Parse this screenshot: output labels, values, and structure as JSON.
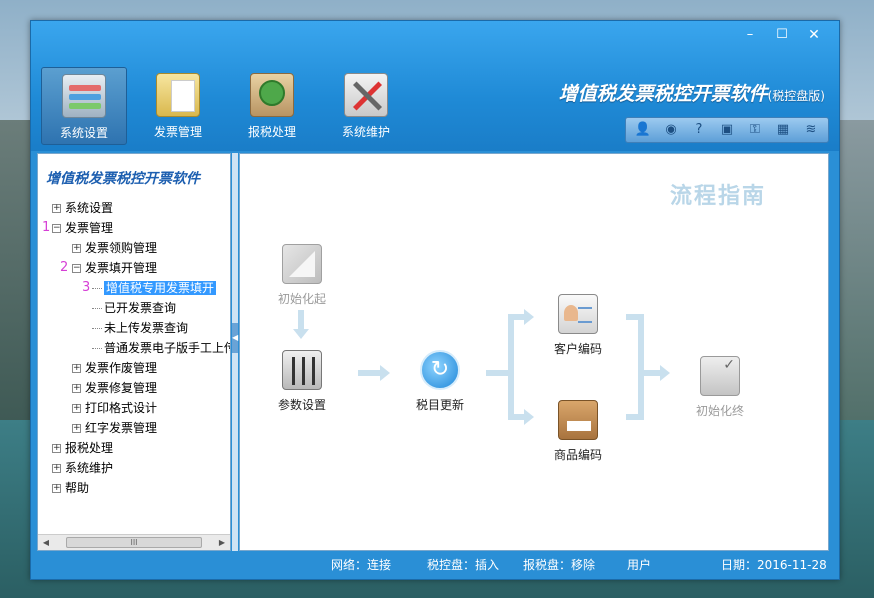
{
  "window": {
    "controls": {
      "minimize": "–",
      "maximize": "☐",
      "close": "✕"
    }
  },
  "toolbar": [
    {
      "label": "系统设置",
      "icon": "settings-panel-icon",
      "active": true
    },
    {
      "label": "发票管理",
      "icon": "invoice-folder-icon",
      "active": false
    },
    {
      "label": "报税处理",
      "icon": "tax-report-icon",
      "active": false
    },
    {
      "label": "系统维护",
      "icon": "maintenance-tools-icon",
      "active": false
    }
  ],
  "brand": {
    "title": "增值税发票税控开票软件",
    "edition": "(税控盘版)"
  },
  "quickbar": [
    {
      "icon": "user-icon",
      "glyph": "👤"
    },
    {
      "icon": "globe-icon",
      "glyph": "◉"
    },
    {
      "icon": "help-icon",
      "glyph": "?"
    },
    {
      "icon": "window-icon",
      "glyph": "▣"
    },
    {
      "icon": "key-icon",
      "glyph": "⚿"
    },
    {
      "icon": "calendar-lock-icon",
      "glyph": "▦"
    },
    {
      "icon": "stack-icon",
      "glyph": "≋"
    }
  ],
  "sidebar": {
    "title": "增值税发票税控开票软件",
    "tree": {
      "system_settings": "系统设置",
      "invoice_mgmt": "发票管理",
      "invoice_purchase": "发票领购管理",
      "invoice_fill": "发票填开管理",
      "vat_special_fill": "增值税专用发票填开",
      "issued_query": "已开发票查询",
      "not_uploaded_query": "未上传发票查询",
      "e_invoice_manual": "普通发票电子版手工上传",
      "invoice_void": "发票作废管理",
      "invoice_repair": "发票修复管理",
      "print_format": "打印格式设计",
      "red_invoice": "红字发票管理",
      "tax_processing": "报税处理",
      "system_maint": "系统维护",
      "help": "帮助"
    },
    "markers": {
      "m1": "1",
      "m2": "2",
      "m3": "3"
    },
    "scroll": {
      "left": "◀",
      "thumb": "III",
      "right": "▶"
    }
  },
  "flow": {
    "title": "流程指南",
    "nodes": {
      "init_start": "初始化起",
      "params": "参数设置",
      "tax_update": "税目更新",
      "client_code": "客户编码",
      "goods_code": "商品编码",
      "init_end": "初始化终"
    }
  },
  "status": {
    "network": "网络：连接",
    "tax_disk": "税控盘：插入",
    "report_disk": "报税盘：移除",
    "user": "用户",
    "date": "日期：2016-11-28"
  }
}
